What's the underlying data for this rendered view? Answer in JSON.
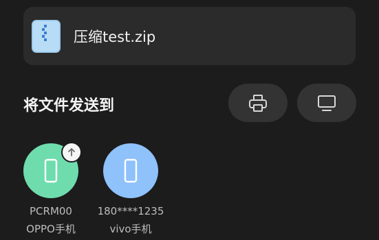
{
  "file": {
    "name": "压缩test.zip",
    "icon": "zip-file-icon"
  },
  "share": {
    "title": "将文件发送到",
    "actions": [
      {
        "label": "print",
        "icon": "printer-icon"
      },
      {
        "label": "screen",
        "icon": "monitor-icon"
      }
    ]
  },
  "devices": [
    {
      "id": "PCRM00",
      "name": "OPPO手机",
      "color": "#6fdcae",
      "icon": "phone-icon",
      "badge": "upload-arrow-icon"
    },
    {
      "id": "180****1235",
      "name": "vivo手机",
      "color": "#8fc1fb",
      "icon": "phone-icon"
    }
  ]
}
